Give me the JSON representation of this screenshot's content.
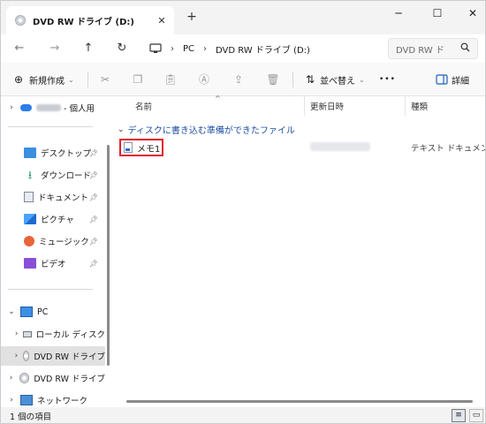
{
  "window": {
    "tab_title": "DVD RW ドライブ (D:)",
    "tab_close": "✕",
    "new_tab": "+",
    "minimize": "─",
    "maximize": "☐",
    "close": "✕"
  },
  "address": {
    "back": "←",
    "forward": "→",
    "up": "↑",
    "refresh": "↻",
    "crumbs": [
      "PC",
      "DVD RW ドライブ (D:)"
    ],
    "separator": "›",
    "search_placeholder": "DVD RW ド"
  },
  "toolbar": {
    "new_label": "新規作成",
    "sort_label": "並べ替え",
    "more": "•••",
    "details_label": "詳細"
  },
  "sidebar": {
    "onedrive_label": "- 個人用",
    "quick": [
      {
        "label": "デスクトップ"
      },
      {
        "label": "ダウンロード"
      },
      {
        "label": "ドキュメント"
      },
      {
        "label": "ピクチャ"
      },
      {
        "label": "ミュージック"
      },
      {
        "label": "ビデオ"
      }
    ],
    "pc_label": "PC",
    "local_disk_label": "ローカル ディスク",
    "dvd_label": "DVD RW ドライブ",
    "dvd2_label": "DVD RW ドライブ",
    "network_label": "ネットワーク"
  },
  "content": {
    "columns": [
      "名前",
      "更新日時",
      "種類"
    ],
    "group_title": "ディスクに書き込む準備ができたファイル",
    "file": {
      "name": "メモ1",
      "type": "テキスト ドキュメント"
    }
  },
  "status": {
    "count": "1 個の項目"
  }
}
